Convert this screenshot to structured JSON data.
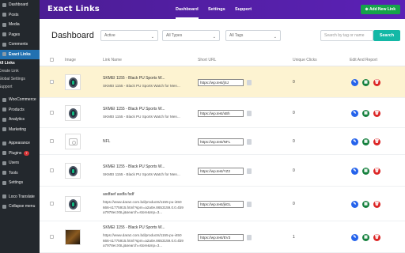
{
  "sidebar": {
    "items": [
      {
        "label": "Dashboard",
        "icon": "dashboard-icon"
      },
      {
        "label": "Posts",
        "icon": "pin-icon"
      },
      {
        "label": "Media",
        "icon": "media-icon"
      },
      {
        "label": "Pages",
        "icon": "pages-icon"
      },
      {
        "label": "Comments",
        "icon": "comment-icon"
      },
      {
        "label": "Exact Links",
        "icon": "link-icon",
        "active": true
      }
    ],
    "submenu": [
      "All Links",
      "Create Link",
      "Global Settings",
      "Support"
    ],
    "items2": [
      {
        "label": "WooCommerce",
        "icon": "woo-icon"
      },
      {
        "label": "Products",
        "icon": "products-icon"
      },
      {
        "label": "Analytics",
        "icon": "analytics-icon"
      },
      {
        "label": "Marketing",
        "icon": "marketing-icon"
      }
    ],
    "items3": [
      {
        "label": "Appearance",
        "icon": "appearance-icon"
      },
      {
        "label": "Plugins",
        "icon": "plugins-icon",
        "badge": "7"
      },
      {
        "label": "Users",
        "icon": "users-icon"
      },
      {
        "label": "Tools",
        "icon": "tools-icon"
      },
      {
        "label": "Settings",
        "icon": "settings-icon"
      }
    ],
    "items4": [
      {
        "label": "Loco Translate",
        "icon": "translate-icon"
      },
      {
        "label": "Collapse menu",
        "icon": "collapse-icon"
      }
    ]
  },
  "topbar": {
    "logo": "Exact Links",
    "tabs": [
      "Dashboard",
      "Settings",
      "Support"
    ],
    "active_tab": "Dashboard",
    "add_button": "⊕ Add New Link",
    "accent": "#5b21b6"
  },
  "toolbar": {
    "title": "Dashboard",
    "status_select": "Active",
    "types_select": "All Types",
    "tags_select": "All Tags",
    "search_placeholder": "Search by tag or name",
    "search_button": "Search"
  },
  "table": {
    "headers": [
      "Image",
      "Link Name",
      "Short URL",
      "Unique Clicks",
      "Edit And Report"
    ],
    "rows": [
      {
        "name1": "SKMEI 1155 - Black PU Sports W...",
        "name2": [
          "SKMEI 1155 - Black PU Sports Watch for Men..."
        ],
        "short_url": "https://wp.test/jSJ",
        "clicks": "0",
        "image": "watch",
        "highlight": true
      },
      {
        "name1": "SKMEI 1155 - Black PU Sports W...",
        "name2": [
          "SKMEI 1155 - Black PU Sports Watch for Men..."
        ],
        "short_url": "https://wp.test/xBh",
        "clicks": "0",
        "image": "watch"
      },
      {
        "name1": "NFL",
        "name2": [],
        "short_url": "https://wp.test/NFL",
        "clicks": "0",
        "image": "placeholder"
      },
      {
        "name1": "SKMEI 1155 - Black PU Sports W...",
        "name2": [
          "SKMEI 1155 - Black PU Sports Watch for Men..."
        ],
        "short_url": "https://wp.test/YZ2",
        "clicks": "0",
        "image": "watch"
      },
      {
        "name1": "asdfaef asdfa fsdf",
        "name2": [
          "https://www.daraz.com.bd/products/1155-pu-i450",
          "666-s1775915.html?spm=a2a0e.8653159.0.0.4b9",
          "a7978ecX5Lj&search=store&mp=3..."
        ],
        "short_url": "https://wp.test/jkGL",
        "clicks": "0",
        "image": "watch"
      },
      {
        "name1": "SKMEI 1155 - Black PU Sports W...",
        "name2": [
          "https://www.daraz.com.bd/products/1155-pu-i450",
          "666-s1775915.html?spm=a2a0e.8653159.0.0.4b9",
          "a7978ecX5Lj&search=store&mp=3..."
        ],
        "short_url": "https://wp.test/EV3",
        "clicks": "1",
        "image": "photo"
      }
    ]
  }
}
